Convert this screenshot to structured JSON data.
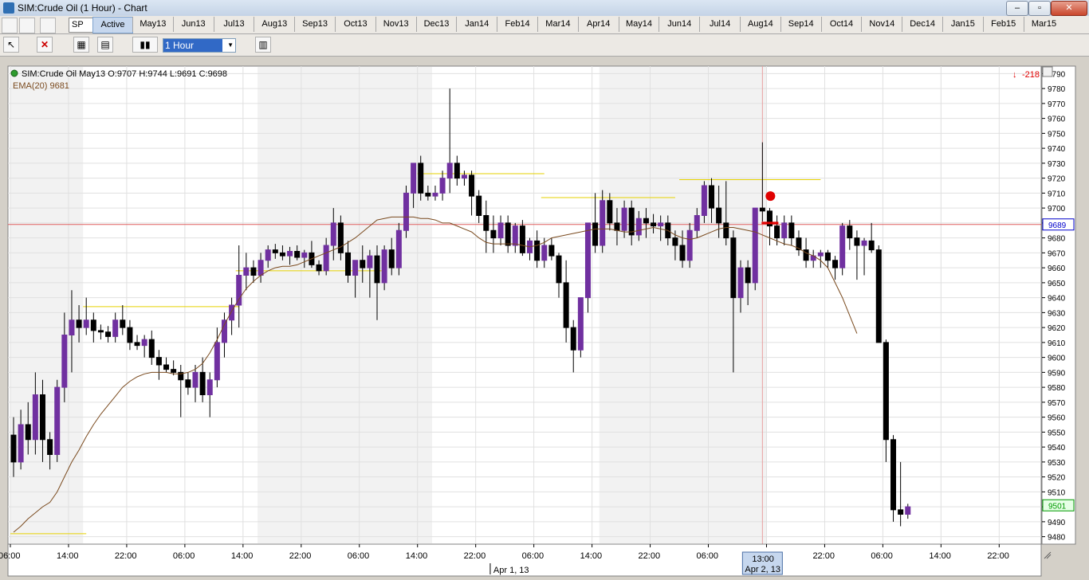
{
  "window": {
    "title": "SIM:Crude Oil (1 Hour) - Chart",
    "minimize_label": "–",
    "maximize_label": "▫",
    "close_label": "✕"
  },
  "tabbar": {
    "symbol_select": "SP",
    "tabs": [
      "Active",
      "May13",
      "Jun13",
      "Jul13",
      "Aug13",
      "Sep13",
      "Oct13",
      "Nov13",
      "Dec13",
      "Jan14",
      "Feb14",
      "Mar14",
      "Apr14",
      "May14",
      "Jun14",
      "Jul14",
      "Aug14",
      "Sep14",
      "Oct14",
      "Nov14",
      "Dec14",
      "Jan15",
      "Feb15",
      "Mar15"
    ],
    "active_tab": "Active"
  },
  "toolbar": {
    "period_value": "1 Hour"
  },
  "colors": {
    "bull": "#7030a0",
    "bear": "#000000",
    "ema": "#7a4a1e",
    "shade": "#f2f2f2",
    "grid": "#e0e0e0",
    "hline": "#e6d200",
    "crosshair": "#e8a0a0",
    "price_line": "#e06060",
    "last_price": "#009900",
    "cursor_price": "#0000cc",
    "arrow": "#e00000"
  },
  "chart_data": {
    "type": "candlestick",
    "instrument": "SIM:Crude Oil May13",
    "header": {
      "label": "SIM:Crude Oil May13",
      "ohlc_text": "O:9707 H:9744 L:9691 C:9698",
      "ema_label": "EMA(20)",
      "ema_value": "9681",
      "pnl": "-218"
    },
    "ylim": [
      9475,
      9795
    ],
    "yticks": [
      9480,
      9490,
      9500,
      9510,
      9520,
      9530,
      9540,
      9550,
      9560,
      9570,
      9580,
      9590,
      9600,
      9610,
      9620,
      9630,
      9640,
      9650,
      9660,
      9670,
      9680,
      9690,
      9700,
      9710,
      9720,
      9730,
      9740,
      9750,
      9760,
      9770,
      9780,
      9790
    ],
    "x_tick_labels": [
      "06:00",
      "14:00",
      "22:00",
      "06:00",
      "14:00",
      "22:00",
      "06:00",
      "14:00",
      "22:00",
      "06:00",
      "14:00",
      "22:00",
      "06:00",
      "14:00",
      "22:00",
      "06:00",
      "14:00",
      "22:00"
    ],
    "x_tick_index": [
      0,
      8,
      16,
      24,
      32,
      40,
      48,
      56,
      64,
      72,
      80,
      88,
      96,
      104,
      112,
      120,
      128,
      136
    ],
    "date_markers": [
      {
        "label": "Apr 1, 13",
        "index": 66
      }
    ],
    "cursor": {
      "time_label": "13:00",
      "date_label": "Apr 2, 13",
      "index": 103,
      "price_label": "9689",
      "price": 9689
    },
    "last_price": {
      "label": "9501",
      "price": 9501
    },
    "sessions_shaded": [
      [
        0,
        10
      ],
      [
        34,
        58
      ],
      [
        81,
        104
      ]
    ],
    "candles": [
      [
        9548,
        9560,
        9520,
        9530
      ],
      [
        9530,
        9565,
        9525,
        9555
      ],
      [
        9555,
        9570,
        9535,
        9545
      ],
      [
        9545,
        9590,
        9535,
        9575
      ],
      [
        9575,
        9585,
        9530,
        9545
      ],
      [
        9545,
        9550,
        9525,
        9535
      ],
      [
        9535,
        9585,
        9530,
        9580
      ],
      [
        9580,
        9630,
        9570,
        9615
      ],
      [
        9615,
        9645,
        9590,
        9625
      ],
      [
        9625,
        9635,
        9610,
        9620
      ],
      [
        9620,
        9640,
        9615,
        9625
      ],
      [
        9625,
        9630,
        9610,
        9618
      ],
      [
        9618,
        9622,
        9612,
        9617
      ],
      [
        9617,
        9621,
        9610,
        9614
      ],
      [
        9614,
        9630,
        9610,
        9625
      ],
      [
        9625,
        9635,
        9615,
        9620
      ],
      [
        9620,
        9625,
        9605,
        9610
      ],
      [
        9610,
        9615,
        9605,
        9608
      ],
      [
        9608,
        9615,
        9600,
        9612
      ],
      [
        9612,
        9618,
        9595,
        9600
      ],
      [
        9600,
        9605,
        9585,
        9595
      ],
      [
        9595,
        9600,
        9590,
        9592
      ],
      [
        9592,
        9598,
        9588,
        9590
      ],
      [
        9590,
        9595,
        9560,
        9585
      ],
      [
        9585,
        9590,
        9575,
        9580
      ],
      [
        9580,
        9595,
        9570,
        9590
      ],
      [
        9590,
        9600,
        9570,
        9575
      ],
      [
        9575,
        9590,
        9560,
        9585
      ],
      [
        9585,
        9620,
        9580,
        9610
      ],
      [
        9610,
        9630,
        9600,
        9625
      ],
      [
        9625,
        9640,
        9615,
        9635
      ],
      [
        9635,
        9675,
        9620,
        9655
      ],
      [
        9655,
        9670,
        9645,
        9660
      ],
      [
        9660,
        9665,
        9650,
        9655
      ],
      [
        9655,
        9670,
        9650,
        9665
      ],
      [
        9665,
        9675,
        9660,
        9672
      ],
      [
        9672,
        9676,
        9666,
        9670
      ],
      [
        9670,
        9675,
        9665,
        9668
      ],
      [
        9668,
        9674,
        9662,
        9671
      ],
      [
        9671,
        9675,
        9665,
        9667
      ],
      [
        9667,
        9672,
        9660,
        9670
      ],
      [
        9670,
        9678,
        9660,
        9662
      ],
      [
        9662,
        9665,
        9655,
        9658
      ],
      [
        9658,
        9680,
        9655,
        9675
      ],
      [
        9675,
        9700,
        9665,
        9690
      ],
      [
        9690,
        9695,
        9665,
        9670
      ],
      [
        9670,
        9678,
        9650,
        9655
      ],
      [
        9655,
        9665,
        9640,
        9665
      ],
      [
        9665,
        9675,
        9650,
        9660
      ],
      [
        9660,
        9672,
        9640,
        9668
      ],
      [
        9668,
        9675,
        9625,
        9650
      ],
      [
        9650,
        9675,
        9645,
        9672
      ],
      [
        9672,
        9680,
        9655,
        9660
      ],
      [
        9660,
        9690,
        9655,
        9685
      ],
      [
        9685,
        9715,
        9680,
        9710
      ],
      [
        9710,
        9730,
        9700,
        9730
      ],
      [
        9730,
        9735,
        9705,
        9710
      ],
      [
        9710,
        9715,
        9705,
        9708
      ],
      [
        9708,
        9715,
        9705,
        9710
      ],
      [
        9710,
        9725,
        9705,
        9720
      ],
      [
        9720,
        9780,
        9710,
        9730
      ],
      [
        9730,
        9735,
        9715,
        9720
      ],
      [
        9720,
        9725,
        9715,
        9722
      ],
      [
        9722,
        9725,
        9695,
        9708
      ],
      [
        9708,
        9712,
        9690,
        9695
      ],
      [
        9695,
        9705,
        9670,
        9685
      ],
      [
        9685,
        9695,
        9670,
        9680
      ],
      [
        9680,
        9695,
        9675,
        9690
      ],
      [
        9690,
        9695,
        9670,
        9675
      ],
      [
        9675,
        9690,
        9670,
        9688
      ],
      [
        9688,
        9692,
        9668,
        9670
      ],
      [
        9670,
        9680,
        9665,
        9678
      ],
      [
        9678,
        9685,
        9660,
        9665
      ],
      [
        9665,
        9680,
        9660,
        9675
      ],
      [
        9675,
        9680,
        9665,
        9668
      ],
      [
        9668,
        9670,
        9640,
        9650
      ],
      [
        9650,
        9665,
        9610,
        9620
      ],
      [
        9620,
        9625,
        9590,
        9605
      ],
      [
        9605,
        9640,
        9600,
        9640
      ],
      [
        9640,
        9690,
        9630,
        9690
      ],
      [
        9690,
        9710,
        9670,
        9675
      ],
      [
        9675,
        9712,
        9670,
        9705
      ],
      [
        9705,
        9710,
        9685,
        9690
      ],
      [
        9690,
        9700,
        9675,
        9685
      ],
      [
        9685,
        9705,
        9680,
        9700
      ],
      [
        9700,
        9705,
        9675,
        9682
      ],
      [
        9682,
        9698,
        9678,
        9693
      ],
      [
        9693,
        9700,
        9680,
        9690
      ],
      [
        9690,
        9696,
        9683,
        9688
      ],
      [
        9688,
        9695,
        9678,
        9690
      ],
      [
        9690,
        9695,
        9675,
        9680
      ],
      [
        9680,
        9685,
        9665,
        9675
      ],
      [
        9675,
        9685,
        9660,
        9665
      ],
      [
        9665,
        9690,
        9660,
        9685
      ],
      [
        9685,
        9700,
        9680,
        9695
      ],
      [
        9695,
        9718,
        9690,
        9715
      ],
      [
        9715,
        9720,
        9690,
        9700
      ],
      [
        9700,
        9715,
        9680,
        9690
      ],
      [
        9690,
        9718,
        9675,
        9680
      ],
      [
        9680,
        9685,
        9590,
        9640
      ],
      [
        9640,
        9665,
        9630,
        9660
      ],
      [
        9660,
        9665,
        9635,
        9650
      ],
      [
        9650,
        9700,
        9645,
        9700
      ],
      [
        9700,
        9744,
        9691,
        9698
      ],
      [
        9698,
        9700,
        9675,
        9688
      ],
      [
        9688,
        9695,
        9675,
        9680
      ],
      [
        9680,
        9695,
        9675,
        9690
      ],
      [
        9690,
        9695,
        9675,
        9680
      ],
      [
        9680,
        9685,
        9668,
        9672
      ],
      [
        9672,
        9680,
        9660,
        9665
      ],
      [
        9665,
        9672,
        9660,
        9668
      ],
      [
        9668,
        9672,
        9660,
        9670
      ],
      [
        9670,
        9672,
        9660,
        9665
      ],
      [
        9665,
        9668,
        9652,
        9660
      ],
      [
        9660,
        9690,
        9655,
        9688
      ],
      [
        9688,
        9692,
        9672,
        9680
      ],
      [
        9680,
        9685,
        9652,
        9675
      ],
      [
        9675,
        9680,
        9655,
        9678
      ],
      [
        9678,
        9690,
        9670,
        9672
      ],
      [
        9672,
        9675,
        9640,
        9610
      ],
      [
        9610,
        9612,
        9530,
        9545
      ],
      [
        9545,
        9548,
        9490,
        9498
      ],
      [
        9498,
        9530,
        9487,
        9495
      ],
      [
        9495,
        9502,
        9492,
        9500
      ]
    ],
    "ema": [
      9483,
      9487,
      9492,
      9496,
      9500,
      9503,
      9510,
      9520,
      9530,
      9538,
      9547,
      9555,
      9562,
      9568,
      9574,
      9580,
      9584,
      9587,
      9589,
      9590,
      9590,
      9590,
      9589,
      9589,
      9590,
      9592,
      9596,
      9603,
      9612,
      9622,
      9631,
      9639,
      9646,
      9651,
      9655,
      9658,
      9660,
      9661,
      9661,
      9662,
      9664,
      9666,
      9668,
      9670,
      9672,
      9674,
      9677,
      9680,
      9684,
      9688,
      9692,
      9693,
      9694,
      9694,
      9694,
      9694,
      9693,
      9693,
      9692,
      9690,
      9690,
      9688,
      9686,
      9684,
      9680,
      9677,
      9676,
      9676,
      9676,
      9676,
      9675,
      9674,
      9675,
      9677,
      9680,
      9681,
      9682,
      9683,
      9684,
      9685,
      9686,
      9686,
      9686,
      9685,
      9684,
      9684,
      9685,
      9686,
      9687,
      9686,
      9685,
      9682,
      9680,
      9679,
      9680,
      9682,
      9684,
      9686,
      9687,
      9687,
      9686,
      9685,
      9684,
      9682,
      9680,
      9678,
      9676,
      9675,
      9673,
      9670,
      9668,
      9665,
      9660,
      9650,
      9640,
      9628,
      9616
    ],
    "support_lines": [
      {
        "price": 9482,
        "from": 0,
        "to": 10
      },
      {
        "price": 9634,
        "from": 10,
        "to": 31
      },
      {
        "price": 9658,
        "from": 31,
        "to": 51
      },
      {
        "price": 9723,
        "from": 56,
        "to": 73
      },
      {
        "price": 9707,
        "from": 73,
        "to": 91
      },
      {
        "price": 9719,
        "from": 92,
        "to": 111
      }
    ]
  }
}
